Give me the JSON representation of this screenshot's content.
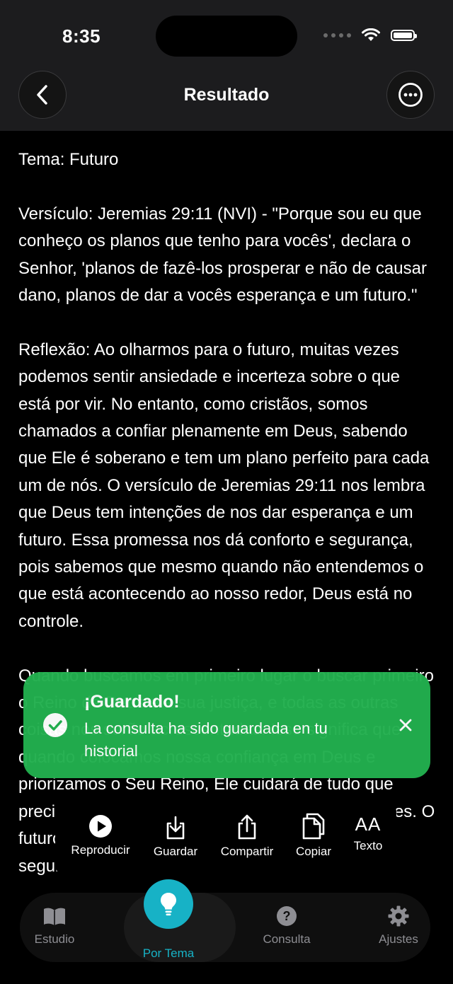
{
  "status": {
    "time": "8:35"
  },
  "header": {
    "title": "Resultado"
  },
  "content": {
    "paragraphs": [
      "Tema: Futuro",
      "Versículo: Jeremias 29:11 (NVI) - \"Porque sou eu que conheço os planos que tenho para vocês', declara o Senhor, 'planos de fazê-los prosperar e não de causar dano, planos de dar a vocês esperança e um futuro.\"",
      "Reflexão: Ao olharmos para o futuro, muitas vezes podemos sentir ansiedade e incerteza sobre o que está por vir. No entanto, como cristãos, somos chamados a confiar plenamente em Deus, sabendo que Ele é soberano e tem um plano perfeito para cada um de nós. O versículo de Jeremias 29:11 nos lembra que Deus tem intenções de nos dar esperança e um futuro. Essa promessa nos dá conforto e segurança, pois sabemos que mesmo quando não entendemos o que está acontecendo ao nosso redor, Deus está no controle.",
      "Quando buscamos em primeiro lugar o buscar primeiro o Reino de Deus e a sua justiça, e todas as outras coisas nos serão acrescentadas. Isso significa que quando colocamos nossa confiança em Deus e priorizamos o Seu Reino, Ele cuidará de tudo que precisamos e suprirá todas as nossas necessidades. O futuro é brilhante quando confiamos em Deus e seguimos os planos de Deus para nossas vidas."
    ]
  },
  "toast": {
    "title": "¡Guardado!",
    "message": "La consulta ha sido guardada en tu historial"
  },
  "actions": {
    "play": "Reproducir",
    "save": "Guardar",
    "share": "Compartir",
    "copy": "Copiar",
    "text_glyph": "AA",
    "text": "Texto"
  },
  "tabs": {
    "study": "Estudio",
    "theme": "Por Tema",
    "query": "Consulta",
    "settings": "Ajustes"
  },
  "colors": {
    "accent": "#17b2c6",
    "toast": "#23b04f",
    "inactive": "#8e8e93"
  }
}
